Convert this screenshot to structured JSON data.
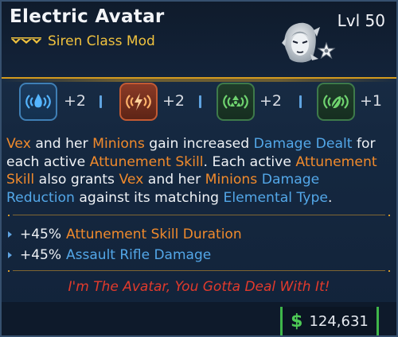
{
  "item": {
    "name": "Electric Avatar",
    "class_mod": "Siren Class Mod",
    "level": "Lvl 50"
  },
  "elements": [
    {
      "icon": "cryo-element-icon",
      "bonus": "+2",
      "color": "#3f7fb5"
    },
    {
      "icon": "incendiary-element-icon",
      "bonus": "+2",
      "color": "#c25a33"
    },
    {
      "icon": "radiation-element-icon",
      "bonus": "+2",
      "color": "#3e7a4a"
    },
    {
      "icon": "corrosive-element-icon",
      "bonus": "+1",
      "color": "#3e7a4a"
    }
  ],
  "description": {
    "line1": [
      "Vex",
      " and her ",
      "Minions",
      " gain increased ",
      "Damage Dealt",
      " for"
    ],
    "line2": [
      "each active ",
      "Attunement Skill",
      ". Each active ",
      "Attunement"
    ],
    "line3": [
      "Skill",
      " also grants ",
      "Vex",
      " and her ",
      "Minions",
      " ",
      "Damage"
    ],
    "line4": [
      "Reduction",
      " against its matching ",
      "Elemental Type",
      "."
    ]
  },
  "stats": [
    {
      "value": "+45%",
      "label": "Attunement Skill Duration"
    },
    {
      "value": "+45%",
      "label": "Assault Rifle Damage"
    }
  ],
  "flavor_text": "I'm The Avatar, You Gotta Deal With It!",
  "price": {
    "symbol": "$",
    "amount": "124,631"
  },
  "colors": {
    "accent_orange": "#f08a2c",
    "accent_blue": "#53a7e8",
    "rarity_gold": "#f0c23e",
    "flavor_red": "#e23a2c",
    "price_green": "#4ecb56"
  }
}
